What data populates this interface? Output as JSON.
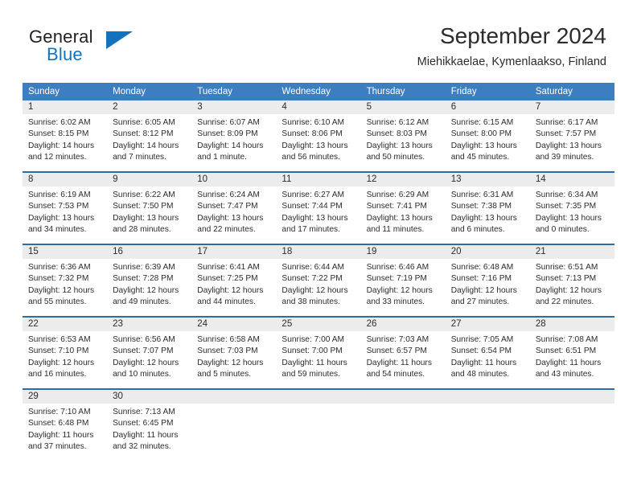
{
  "brand": {
    "name_part1": "General",
    "name_part2": "Blue",
    "flag_icon": "triangle-flag-icon"
  },
  "header": {
    "title": "September 2024",
    "location": "Miehikkaelae, Kymenlaakso, Finland"
  },
  "colors": {
    "header_blue": "#3c7ebf",
    "row_divider_blue": "#2e6da4",
    "daynum_gray": "#ececec",
    "brand_blue": "#1272bd",
    "text": "#2b2b2b"
  },
  "weekdays": [
    "Sunday",
    "Monday",
    "Tuesday",
    "Wednesday",
    "Thursday",
    "Friday",
    "Saturday"
  ],
  "weeks": [
    [
      {
        "day": "1",
        "sunrise": "Sunrise: 6:02 AM",
        "sunset": "Sunset: 8:15 PM",
        "daylight_line1": "Daylight: 14 hours",
        "daylight_line2": "and 12 minutes."
      },
      {
        "day": "2",
        "sunrise": "Sunrise: 6:05 AM",
        "sunset": "Sunset: 8:12 PM",
        "daylight_line1": "Daylight: 14 hours",
        "daylight_line2": "and 7 minutes."
      },
      {
        "day": "3",
        "sunrise": "Sunrise: 6:07 AM",
        "sunset": "Sunset: 8:09 PM",
        "daylight_line1": "Daylight: 14 hours",
        "daylight_line2": "and 1 minute."
      },
      {
        "day": "4",
        "sunrise": "Sunrise: 6:10 AM",
        "sunset": "Sunset: 8:06 PM",
        "daylight_line1": "Daylight: 13 hours",
        "daylight_line2": "and 56 minutes."
      },
      {
        "day": "5",
        "sunrise": "Sunrise: 6:12 AM",
        "sunset": "Sunset: 8:03 PM",
        "daylight_line1": "Daylight: 13 hours",
        "daylight_line2": "and 50 minutes."
      },
      {
        "day": "6",
        "sunrise": "Sunrise: 6:15 AM",
        "sunset": "Sunset: 8:00 PM",
        "daylight_line1": "Daylight: 13 hours",
        "daylight_line2": "and 45 minutes."
      },
      {
        "day": "7",
        "sunrise": "Sunrise: 6:17 AM",
        "sunset": "Sunset: 7:57 PM",
        "daylight_line1": "Daylight: 13 hours",
        "daylight_line2": "and 39 minutes."
      }
    ],
    [
      {
        "day": "8",
        "sunrise": "Sunrise: 6:19 AM",
        "sunset": "Sunset: 7:53 PM",
        "daylight_line1": "Daylight: 13 hours",
        "daylight_line2": "and 34 minutes."
      },
      {
        "day": "9",
        "sunrise": "Sunrise: 6:22 AM",
        "sunset": "Sunset: 7:50 PM",
        "daylight_line1": "Daylight: 13 hours",
        "daylight_line2": "and 28 minutes."
      },
      {
        "day": "10",
        "sunrise": "Sunrise: 6:24 AM",
        "sunset": "Sunset: 7:47 PM",
        "daylight_line1": "Daylight: 13 hours",
        "daylight_line2": "and 22 minutes."
      },
      {
        "day": "11",
        "sunrise": "Sunrise: 6:27 AM",
        "sunset": "Sunset: 7:44 PM",
        "daylight_line1": "Daylight: 13 hours",
        "daylight_line2": "and 17 minutes."
      },
      {
        "day": "12",
        "sunrise": "Sunrise: 6:29 AM",
        "sunset": "Sunset: 7:41 PM",
        "daylight_line1": "Daylight: 13 hours",
        "daylight_line2": "and 11 minutes."
      },
      {
        "day": "13",
        "sunrise": "Sunrise: 6:31 AM",
        "sunset": "Sunset: 7:38 PM",
        "daylight_line1": "Daylight: 13 hours",
        "daylight_line2": "and 6 minutes."
      },
      {
        "day": "14",
        "sunrise": "Sunrise: 6:34 AM",
        "sunset": "Sunset: 7:35 PM",
        "daylight_line1": "Daylight: 13 hours",
        "daylight_line2": "and 0 minutes."
      }
    ],
    [
      {
        "day": "15",
        "sunrise": "Sunrise: 6:36 AM",
        "sunset": "Sunset: 7:32 PM",
        "daylight_line1": "Daylight: 12 hours",
        "daylight_line2": "and 55 minutes."
      },
      {
        "day": "16",
        "sunrise": "Sunrise: 6:39 AM",
        "sunset": "Sunset: 7:28 PM",
        "daylight_line1": "Daylight: 12 hours",
        "daylight_line2": "and 49 minutes."
      },
      {
        "day": "17",
        "sunrise": "Sunrise: 6:41 AM",
        "sunset": "Sunset: 7:25 PM",
        "daylight_line1": "Daylight: 12 hours",
        "daylight_line2": "and 44 minutes."
      },
      {
        "day": "18",
        "sunrise": "Sunrise: 6:44 AM",
        "sunset": "Sunset: 7:22 PM",
        "daylight_line1": "Daylight: 12 hours",
        "daylight_line2": "and 38 minutes."
      },
      {
        "day": "19",
        "sunrise": "Sunrise: 6:46 AM",
        "sunset": "Sunset: 7:19 PM",
        "daylight_line1": "Daylight: 12 hours",
        "daylight_line2": "and 33 minutes."
      },
      {
        "day": "20",
        "sunrise": "Sunrise: 6:48 AM",
        "sunset": "Sunset: 7:16 PM",
        "daylight_line1": "Daylight: 12 hours",
        "daylight_line2": "and 27 minutes."
      },
      {
        "day": "21",
        "sunrise": "Sunrise: 6:51 AM",
        "sunset": "Sunset: 7:13 PM",
        "daylight_line1": "Daylight: 12 hours",
        "daylight_line2": "and 22 minutes."
      }
    ],
    [
      {
        "day": "22",
        "sunrise": "Sunrise: 6:53 AM",
        "sunset": "Sunset: 7:10 PM",
        "daylight_line1": "Daylight: 12 hours",
        "daylight_line2": "and 16 minutes."
      },
      {
        "day": "23",
        "sunrise": "Sunrise: 6:56 AM",
        "sunset": "Sunset: 7:07 PM",
        "daylight_line1": "Daylight: 12 hours",
        "daylight_line2": "and 10 minutes."
      },
      {
        "day": "24",
        "sunrise": "Sunrise: 6:58 AM",
        "sunset": "Sunset: 7:03 PM",
        "daylight_line1": "Daylight: 12 hours",
        "daylight_line2": "and 5 minutes."
      },
      {
        "day": "25",
        "sunrise": "Sunrise: 7:00 AM",
        "sunset": "Sunset: 7:00 PM",
        "daylight_line1": "Daylight: 11 hours",
        "daylight_line2": "and 59 minutes."
      },
      {
        "day": "26",
        "sunrise": "Sunrise: 7:03 AM",
        "sunset": "Sunset: 6:57 PM",
        "daylight_line1": "Daylight: 11 hours",
        "daylight_line2": "and 54 minutes."
      },
      {
        "day": "27",
        "sunrise": "Sunrise: 7:05 AM",
        "sunset": "Sunset: 6:54 PM",
        "daylight_line1": "Daylight: 11 hours",
        "daylight_line2": "and 48 minutes."
      },
      {
        "day": "28",
        "sunrise": "Sunrise: 7:08 AM",
        "sunset": "Sunset: 6:51 PM",
        "daylight_line1": "Daylight: 11 hours",
        "daylight_line2": "and 43 minutes."
      }
    ],
    [
      {
        "day": "29",
        "sunrise": "Sunrise: 7:10 AM",
        "sunset": "Sunset: 6:48 PM",
        "daylight_line1": "Daylight: 11 hours",
        "daylight_line2": "and 37 minutes."
      },
      {
        "day": "30",
        "sunrise": "Sunrise: 7:13 AM",
        "sunset": "Sunset: 6:45 PM",
        "daylight_line1": "Daylight: 11 hours",
        "daylight_line2": "and 32 minutes."
      },
      {
        "day": "",
        "sunrise": "",
        "sunset": "",
        "daylight_line1": "",
        "daylight_line2": ""
      },
      {
        "day": "",
        "sunrise": "",
        "sunset": "",
        "daylight_line1": "",
        "daylight_line2": ""
      },
      {
        "day": "",
        "sunrise": "",
        "sunset": "",
        "daylight_line1": "",
        "daylight_line2": ""
      },
      {
        "day": "",
        "sunrise": "",
        "sunset": "",
        "daylight_line1": "",
        "daylight_line2": ""
      },
      {
        "day": "",
        "sunrise": "",
        "sunset": "",
        "daylight_line1": "",
        "daylight_line2": ""
      }
    ]
  ]
}
